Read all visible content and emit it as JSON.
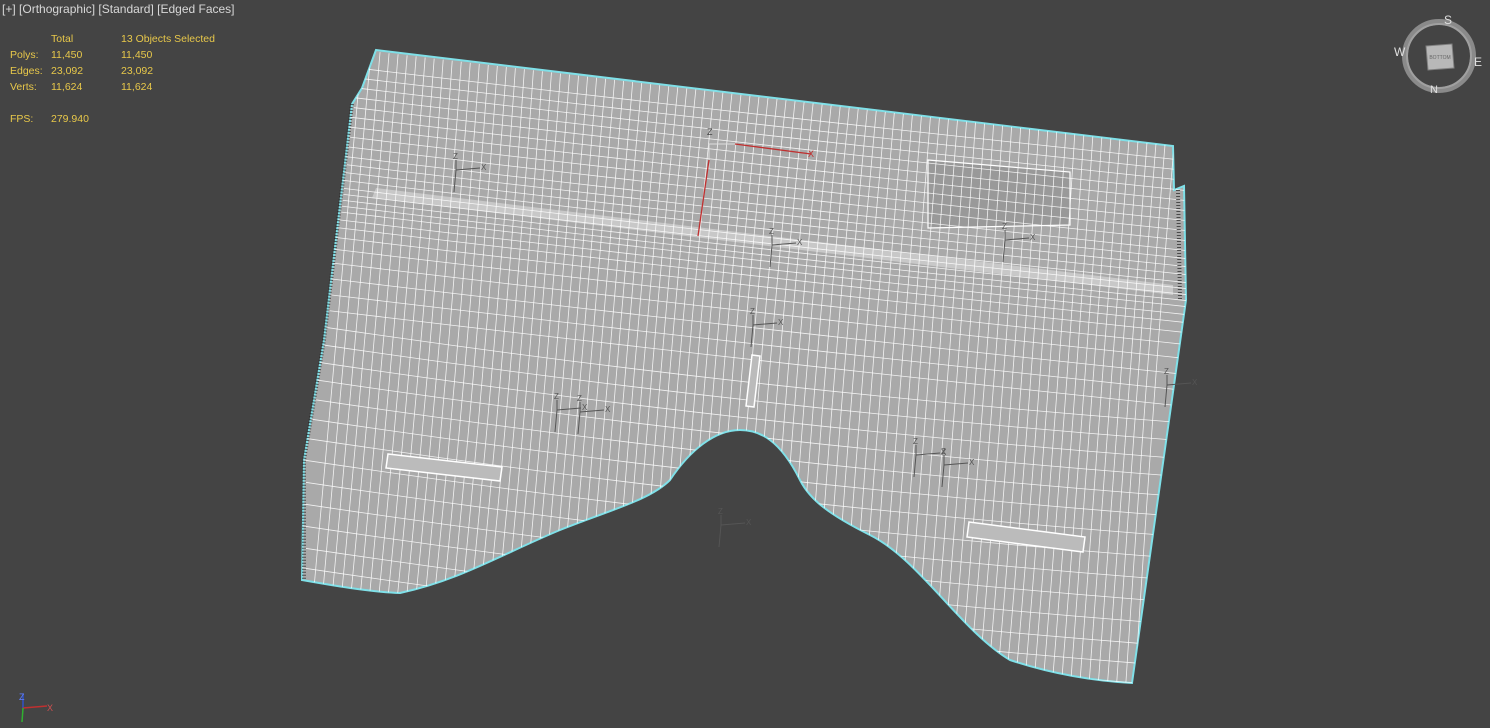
{
  "viewport": {
    "label_parts": [
      "[+]",
      "[Orthographic]",
      "[Standard]",
      "[Edged Faces]"
    ],
    "background": "#444444"
  },
  "stats": {
    "headers": [
      "",
      "Total",
      "13 Objects Selected"
    ],
    "rows": [
      {
        "label": "Polys:",
        "total": "11,450",
        "selected": "11,450"
      },
      {
        "label": "Edges:",
        "total": "23,092",
        "selected": "23,092"
      },
      {
        "label": "Verts:",
        "total": "11,624",
        "selected": "11,624"
      }
    ],
    "fps_label": "FPS:",
    "fps_value": "279.940",
    "color": "#e8c84a"
  },
  "viewcube": {
    "letters": {
      "s": "S",
      "w": "W",
      "e": "E",
      "n": "N"
    },
    "face": "BOTTOM"
  },
  "gizmo_labels": {
    "z": "Z",
    "x": "X"
  },
  "colors": {
    "mesh_fill": "#a9a9a9",
    "wire": "#ffffff",
    "selection_outline": "#7fe0e8",
    "axis_red": "#c03030",
    "axis_blue": "#3050c8",
    "axis_green": "#30b030"
  }
}
